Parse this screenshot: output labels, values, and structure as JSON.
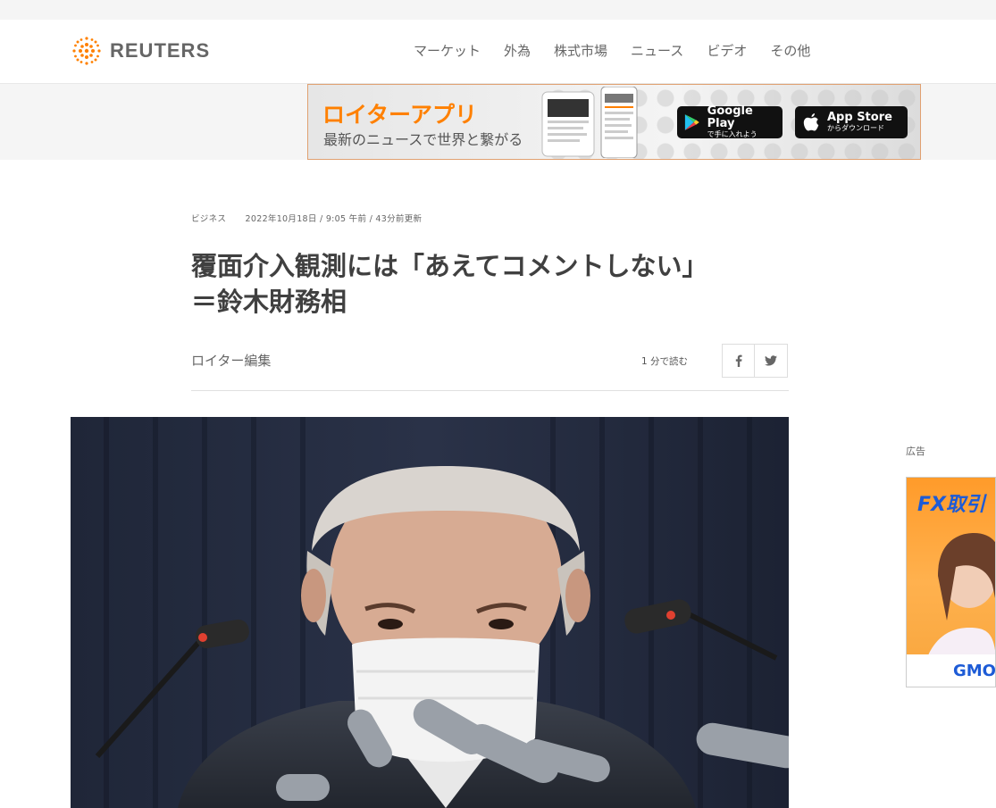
{
  "brand": {
    "name": "REUTERS",
    "accent": "#ff8000"
  },
  "nav": {
    "items": [
      "マーケット",
      "外為",
      "株式市場",
      "ニュース",
      "ビデオ",
      "その他"
    ]
  },
  "app_banner": {
    "title": "ロイターアプリ",
    "subtitle": "最新のニュースで世界と繋がる",
    "google_play": {
      "label": "Google Play",
      "sub": "で手に入れよう"
    },
    "app_store": {
      "label": "App Store",
      "sub": "からダウンロード"
    }
  },
  "article": {
    "category": "ビジネス",
    "date": "2022年10月18日 / 9:05 午前 / 43分前更新",
    "headline_line1": "覆面介入観測には「あえてコメントしない」",
    "headline_line2": "＝鈴木財務相",
    "byline": "ロイター編集",
    "read_time": "1 分で読む",
    "share": {
      "facebook_icon": "facebook-icon",
      "twitter_icon": "twitter-icon"
    }
  },
  "ad": {
    "label": "広告",
    "headline": "FX取引",
    "brand": "GMO"
  }
}
